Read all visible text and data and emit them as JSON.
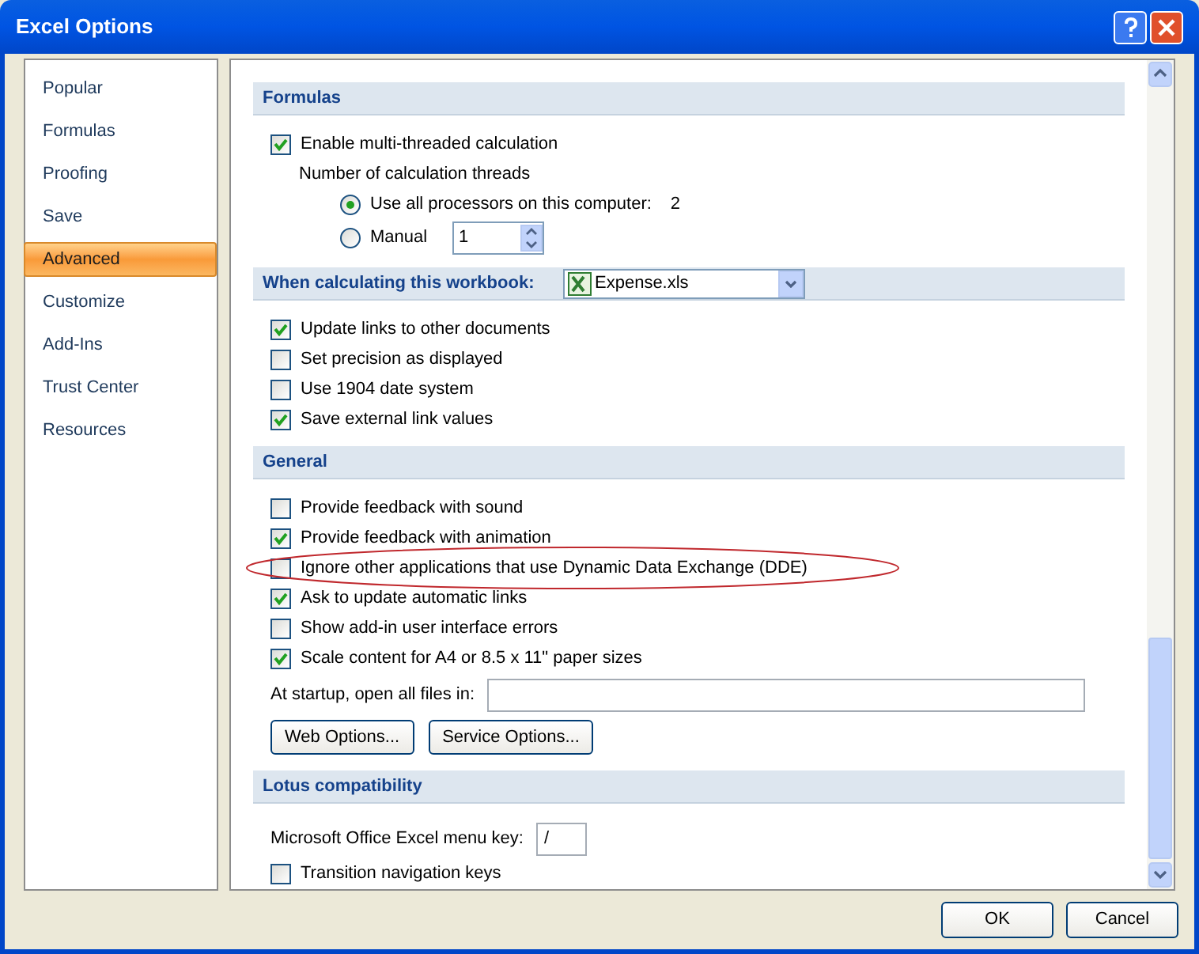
{
  "window": {
    "title": "Excel Options"
  },
  "sidebar": {
    "items": [
      {
        "label": "Popular",
        "selected": false
      },
      {
        "label": "Formulas",
        "selected": false
      },
      {
        "label": "Proofing",
        "selected": false
      },
      {
        "label": "Save",
        "selected": false
      },
      {
        "label": "Advanced",
        "selected": true
      },
      {
        "label": "Customize",
        "selected": false
      },
      {
        "label": "Add-Ins",
        "selected": false
      },
      {
        "label": "Trust Center",
        "selected": false
      },
      {
        "label": "Resources",
        "selected": false
      }
    ]
  },
  "sections": [
    {
      "title": "Formulas",
      "rows": [
        {
          "kind": "checkbox",
          "label": "Enable multi-threaded calculation",
          "checked": true
        },
        {
          "kind": "text",
          "label": "Number of calculation threads"
        },
        {
          "kind": "radio",
          "label": "Use all processors on this computer:",
          "selected": true,
          "value": "2"
        },
        {
          "kind": "radio",
          "label": "Manual",
          "selected": false,
          "spinner": "1"
        }
      ]
    },
    {
      "title": "When calculating this workbook:",
      "dropdown": "Expense.xls",
      "rows": [
        {
          "kind": "checkbox",
          "label": "Update links to other documents",
          "checked": true
        },
        {
          "kind": "checkbox",
          "label": "Set precision as displayed",
          "checked": false
        },
        {
          "kind": "checkbox",
          "label": "Use 1904 date system",
          "checked": false
        },
        {
          "kind": "checkbox",
          "label": "Save external link values",
          "checked": true
        }
      ]
    },
    {
      "title": "General",
      "rows": [
        {
          "kind": "checkbox",
          "label": "Provide feedback with sound",
          "checked": false
        },
        {
          "kind": "checkbox",
          "label": "Provide feedback with animation",
          "checked": true
        },
        {
          "kind": "checkbox",
          "label": "Ignore other applications that use Dynamic Data Exchange (DDE)",
          "checked": false,
          "circled": true
        },
        {
          "kind": "checkbox",
          "label": "Ask to update automatic links",
          "checked": true
        },
        {
          "kind": "checkbox",
          "label": "Show add-in user interface errors",
          "checked": false
        },
        {
          "kind": "checkbox",
          "label": "Scale content for A4 or 8.5 x 11\" paper sizes",
          "checked": true
        },
        {
          "kind": "field",
          "label": "At startup, open all files in:",
          "wide": true
        },
        {
          "kind": "buttons",
          "buttons": [
            "Web Options...",
            "Service Options..."
          ]
        }
      ]
    },
    {
      "title": "Lotus compatibility",
      "rows": [
        {
          "kind": "field",
          "label": "Microsoft Office Excel menu key:",
          "value": "/"
        },
        {
          "kind": "checkbox",
          "label": "Transition navigation keys",
          "checked": false
        }
      ]
    }
  ],
  "buttons": [
    "OK",
    "Cancel"
  ]
}
